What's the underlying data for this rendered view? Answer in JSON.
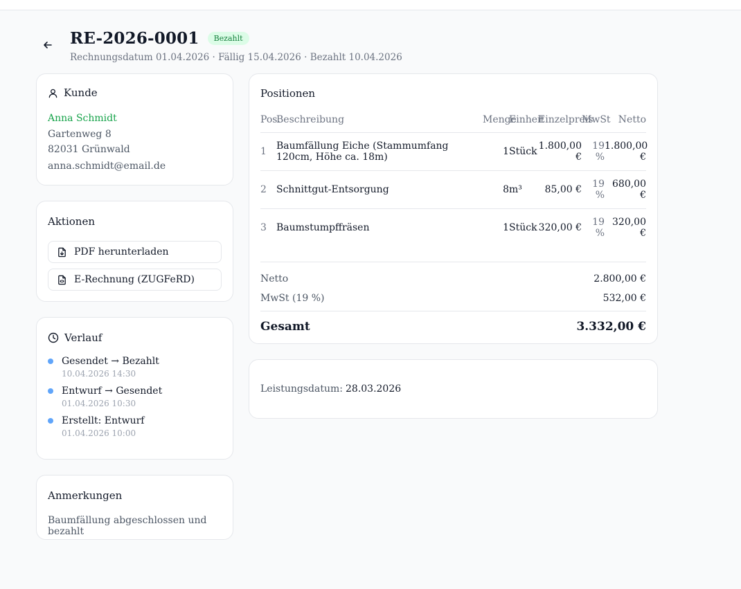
{
  "header": {
    "title": "RE-2026-0001",
    "status": "Bezahlt",
    "subtitle": "Rechnungsdatum 01.04.2026 · Fällig 15.04.2026 · Bezahlt 10.04.2026"
  },
  "customer": {
    "heading": "Kunde",
    "name": "Anna Schmidt",
    "street": "Gartenweg 8",
    "city": "82031 Grünwald",
    "email": "anna.schmidt@email.de"
  },
  "actions": {
    "heading": "Aktionen",
    "pdf_label": "PDF herunterladen",
    "erechnung_label": "E-Rechnung (ZUGFeRD)"
  },
  "history": {
    "heading": "Verlauf",
    "items": [
      {
        "text": "Gesendet → Bezahlt",
        "time": "10.04.2026 14:30"
      },
      {
        "text": "Entwurf → Gesendet",
        "time": "01.04.2026 10:30"
      },
      {
        "text": "Erstellt: Entwurf",
        "time": "01.04.2026 10:00"
      }
    ]
  },
  "notes": {
    "heading": "Anmerkungen",
    "text": "Baumfällung abgeschlossen und bezahlt"
  },
  "positions": {
    "heading": "Positionen",
    "columns": {
      "pos": "Pos.",
      "description": "Beschreibung",
      "qty": "Menge",
      "unit": "Einheit",
      "unit_price": "Einzelpreis",
      "vat": "MwSt",
      "net": "Netto"
    },
    "rows": [
      {
        "pos": "1",
        "description": "Baumfällung Eiche (Stammumfang 120cm, Höhe ca. 18m)",
        "qty": "1",
        "unit": "Stück",
        "unit_price": "1.800,00 €",
        "vat": "19 %",
        "net": "1.800,00 €"
      },
      {
        "pos": "2",
        "description": "Schnittgut-Entsorgung",
        "qty": "8",
        "unit": "m³",
        "unit_price": "85,00 €",
        "vat": "19 %",
        "net": "680,00 €"
      },
      {
        "pos": "3",
        "description": "Baumstumpffräsen",
        "qty": "1",
        "unit": "Stück",
        "unit_price": "320,00 €",
        "vat": "19 %",
        "net": "320,00 €"
      }
    ],
    "totals": {
      "net_label": "Netto",
      "net_value": "2.800,00 €",
      "vat_label": "MwSt (19 %)",
      "vat_value": "532,00 €",
      "total_label": "Gesamt",
      "total_value": "3.332,00 €"
    }
  },
  "service": {
    "label": "Leistungsdatum:",
    "value": "28.03.2026"
  },
  "colors": {
    "accent_green": "#16a34a",
    "badge_bg": "#dcfce7",
    "timeline_dot": "#60a5fa"
  }
}
